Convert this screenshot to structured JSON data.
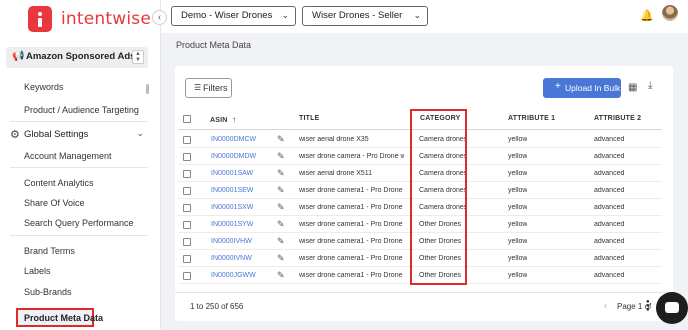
{
  "brand": {
    "name": "intentwise"
  },
  "topbar": {
    "account_dropdown": "Demo - Wiser Drones",
    "profile_dropdown": "Wiser Drones - Seller"
  },
  "sidebar": {
    "ads_selector": "Amazon Sponsored Ads",
    "items_top": [
      "Keywords",
      "Product / Audience Targeting"
    ],
    "section": "Global Settings",
    "items_settings": [
      "Account Management"
    ],
    "items_analytics": [
      "Content Analytics",
      "Share Of Voice",
      "Search Query Performance"
    ],
    "items_other": [
      "Brand Terms",
      "Labels",
      "Sub-Brands"
    ],
    "active_item": "Product Meta Data"
  },
  "page": {
    "title": "Product Meta Data"
  },
  "toolbar": {
    "filters_label": "Filters",
    "upload_label": "Upload In Bulk"
  },
  "table": {
    "headers": [
      "ASIN",
      "TITLE",
      "CATEGORY",
      "ATTRIBUTE 1",
      "ATTRIBUTE 2"
    ],
    "rows": [
      {
        "asin": "IN0000DMCW",
        "title": "wiser aerial drone X35",
        "category": "Camera drones",
        "attr1": "yellow",
        "attr2": "advanced"
      },
      {
        "asin": "IN0000DMDW",
        "title": "wiser drone camera - Pro Drone with C...",
        "category": "Camera drones",
        "attr1": "yellow",
        "attr2": "advanced"
      },
      {
        "asin": "IN00001SAW",
        "title": "wiser aerial drone X511",
        "category": "Camera drones",
        "attr1": "yellow",
        "attr2": "advanced"
      },
      {
        "asin": "IN00001SEW",
        "title": "wiser drone camera1 - Pro Drone with...",
        "category": "Camera drones",
        "attr1": "yellow",
        "attr2": "advanced"
      },
      {
        "asin": "IN00001SXW",
        "title": "wiser drone camera1 - Pro Drone with...",
        "category": "Camera drones",
        "attr1": "yellow",
        "attr2": "advanced"
      },
      {
        "asin": "IN00001SYW",
        "title": "wiser drone camera1 - Pro Drone with...",
        "category": "Other Drones",
        "attr1": "yellow",
        "attr2": "advanced"
      },
      {
        "asin": "IN0000IVHW",
        "title": "wiser drone camera1 - Pro Drone with...",
        "category": "Other Drones",
        "attr1": "yellow",
        "attr2": "advanced"
      },
      {
        "asin": "IN0000IVNW",
        "title": "wiser drone camera1 - Pro Drone with...",
        "category": "Other Drones",
        "attr1": "yellow",
        "attr2": "advanced"
      },
      {
        "asin": "IN0000JGWW",
        "title": "wiser drone camera1 - Pro Drone with...",
        "category": "Other Drones",
        "attr1": "yellow",
        "attr2": "advanced"
      },
      {
        "asin": "IN0000JUJW",
        "title": "wiser drone camera1 - Pro Drone with...",
        "category": "Other Drones",
        "attr1": "yellow",
        "attr2": "advanced"
      }
    ]
  },
  "footer": {
    "range": "1 to 250 of 656",
    "page_info": "Page 1 of"
  },
  "colors": {
    "brand": "#e8383d",
    "primary": "#4a77d6",
    "highlight": "#e02a2a"
  }
}
